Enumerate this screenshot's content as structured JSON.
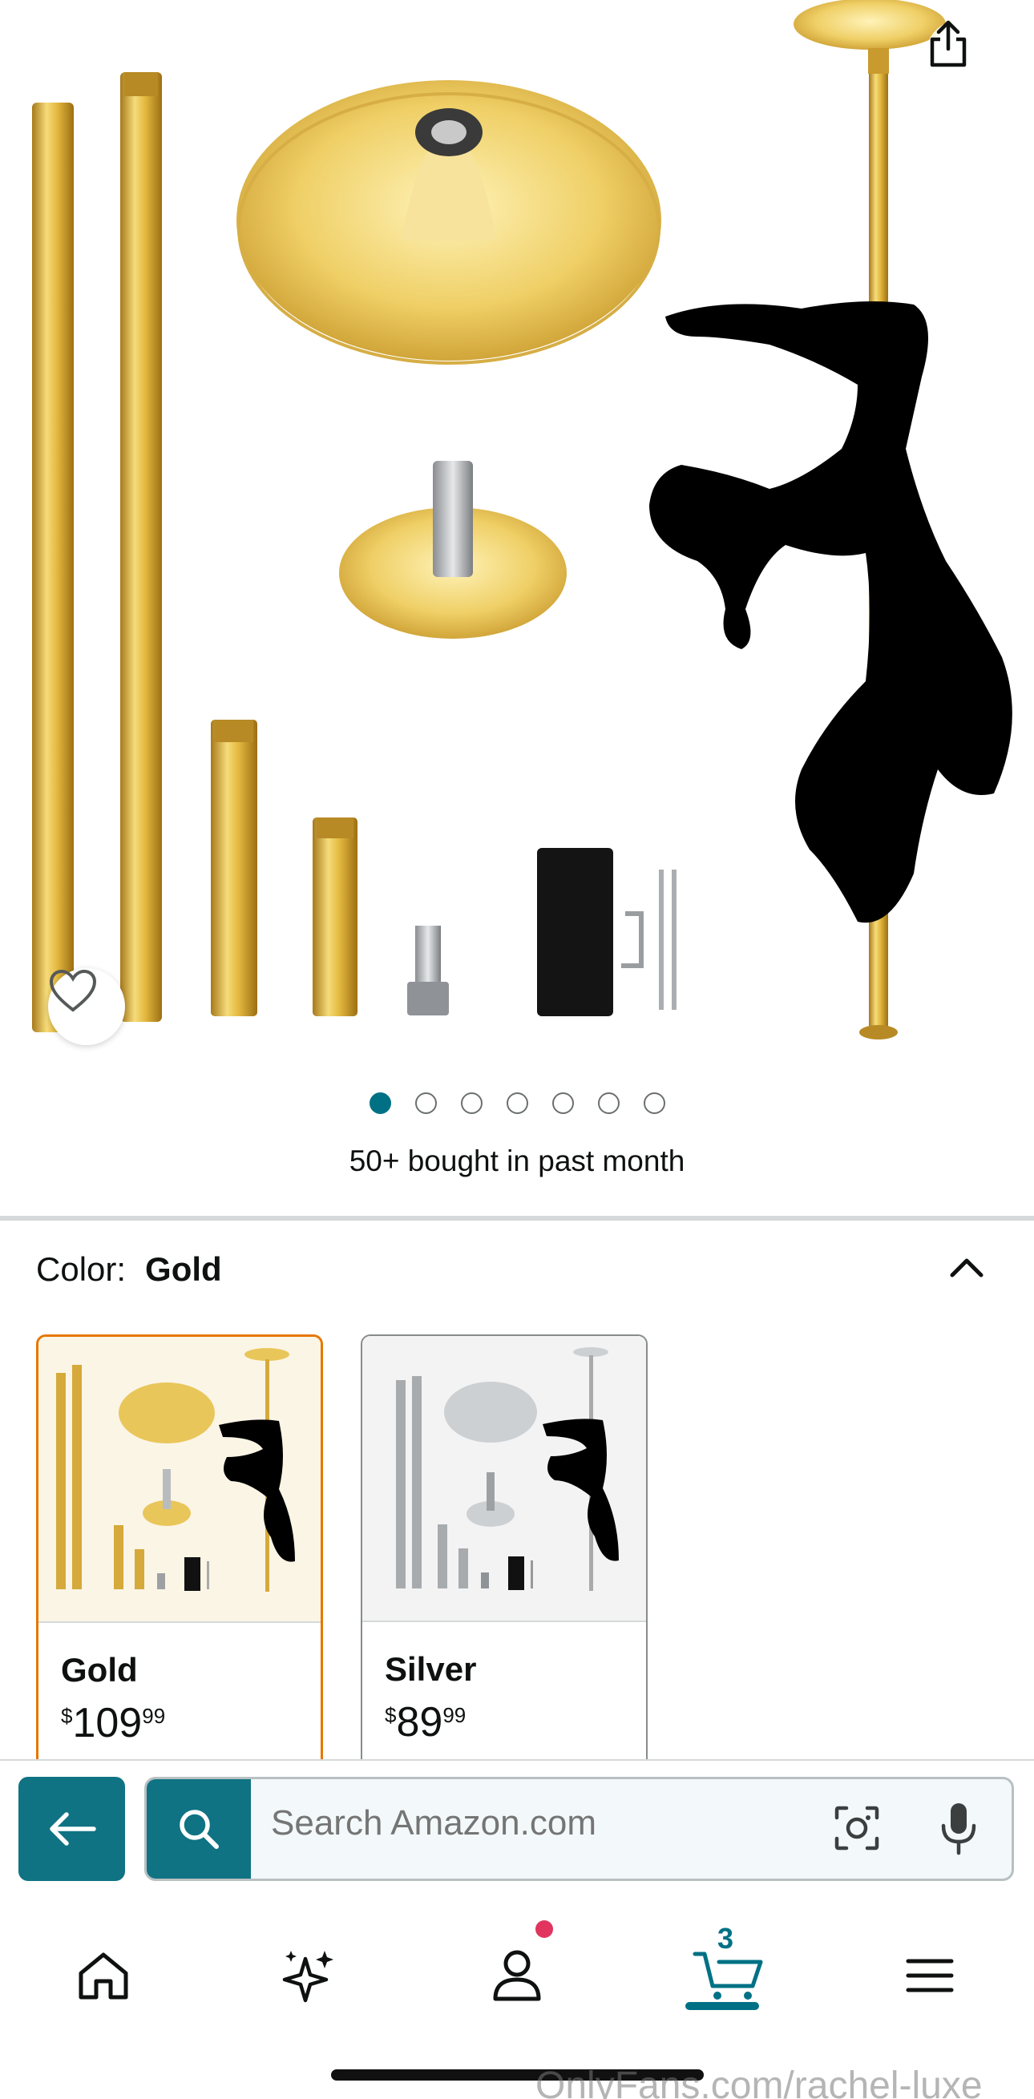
{
  "product": {
    "bought_text": "50+ bought in past month",
    "carousel": {
      "total": 7,
      "active": 1
    }
  },
  "color": {
    "label": "Color:",
    "selected": "Gold",
    "options": [
      {
        "name": "Gold",
        "currency": "$",
        "price_whole": "109",
        "price_fraction": "99"
      },
      {
        "name": "Silver",
        "currency": "$",
        "price_whole": "89",
        "price_fraction": "99"
      }
    ]
  },
  "search": {
    "placeholder": "Search Amazon.com"
  },
  "nav": {
    "cart_count": "3"
  },
  "watermark": "OnlyFans.com/rachel-luxe",
  "colors": {
    "accent": "#007185",
    "button": "#0f7383",
    "selected_border": "#e77600",
    "gold": "#e2b93b",
    "badge": "#e1345f"
  },
  "icons": [
    "share-icon",
    "heart-icon",
    "chevron-up-icon",
    "back-arrow-icon",
    "search-icon",
    "camera-icon",
    "mic-icon",
    "home-icon",
    "sparkle-icon",
    "profile-icon",
    "cart-icon",
    "menu-icon"
  ]
}
